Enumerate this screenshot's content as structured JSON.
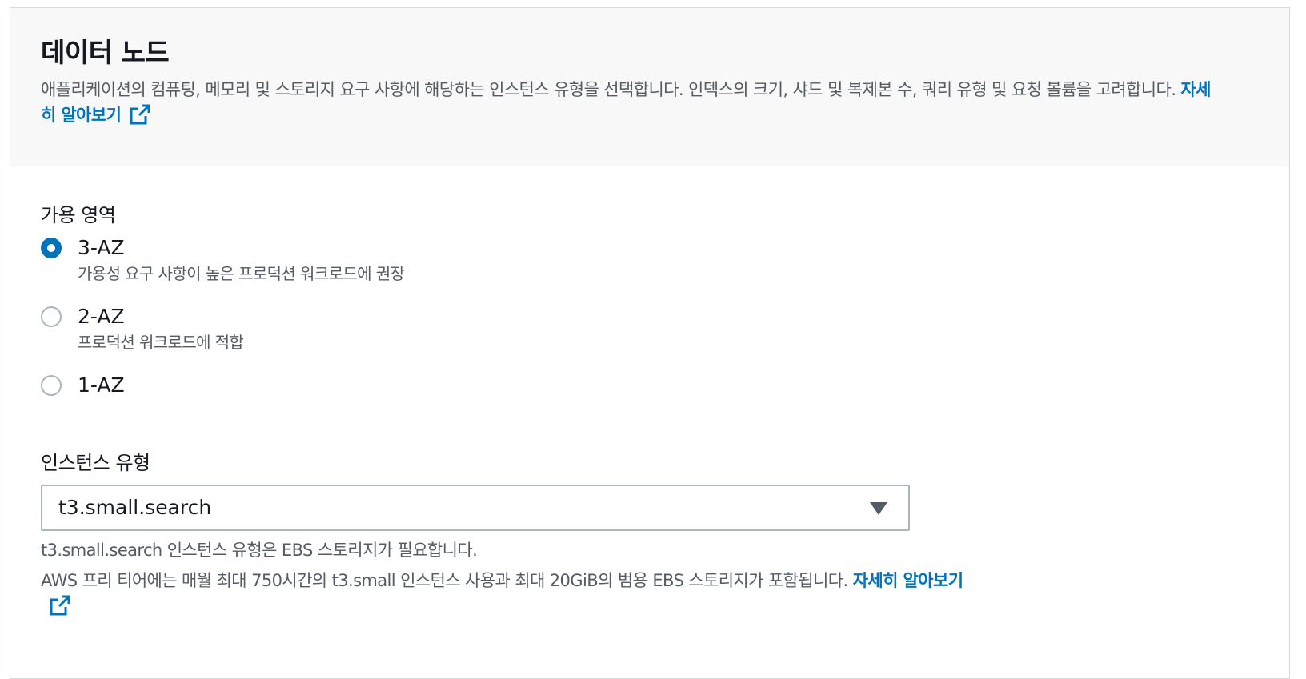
{
  "header": {
    "title": "데이터 노드",
    "description": "애플리케이션의 컴퓨팅, 메모리 및 스토리지 요구 사항에 해당하는 인스턴스 유형을 선택합니다. 인덱스의 크기, 샤드 및 복제본 수, 쿼리 유형 및 요청 볼륨을 고려합니다.",
    "learn_more": "자세히 알아보기"
  },
  "availability_zone": {
    "label": "가용 영역",
    "options": [
      {
        "label": "3-AZ",
        "description": "가용성 요구 사항이 높은 프로덕션 워크로드에 권장",
        "selected": true
      },
      {
        "label": "2-AZ",
        "description": "프로덕션 워크로드에 적합",
        "selected": false
      },
      {
        "label": "1-AZ",
        "description": "",
        "selected": false
      }
    ]
  },
  "instance_type": {
    "label": "인스턴스 유형",
    "selected_value": "t3.small.search",
    "hint_ebs": "t3.small.search 인스턴스 유형은 EBS 스토리지가 필요합니다.",
    "hint_free_tier": "AWS 프리 티어에는 매월 최대 750시간의 t3.small 인스턴스 사용과 최대 20GiB의 범용 EBS 스토리지가 포함됩니다.",
    "learn_more": "자세히 알아보기"
  },
  "colors": {
    "link": "#0073bb",
    "radio_selected": "#0073bb",
    "header_bg": "#f8f8f8",
    "border": "#d5dbdb"
  },
  "icons": {
    "external_link": "external-link-icon",
    "dropdown": "caret-down-icon"
  }
}
